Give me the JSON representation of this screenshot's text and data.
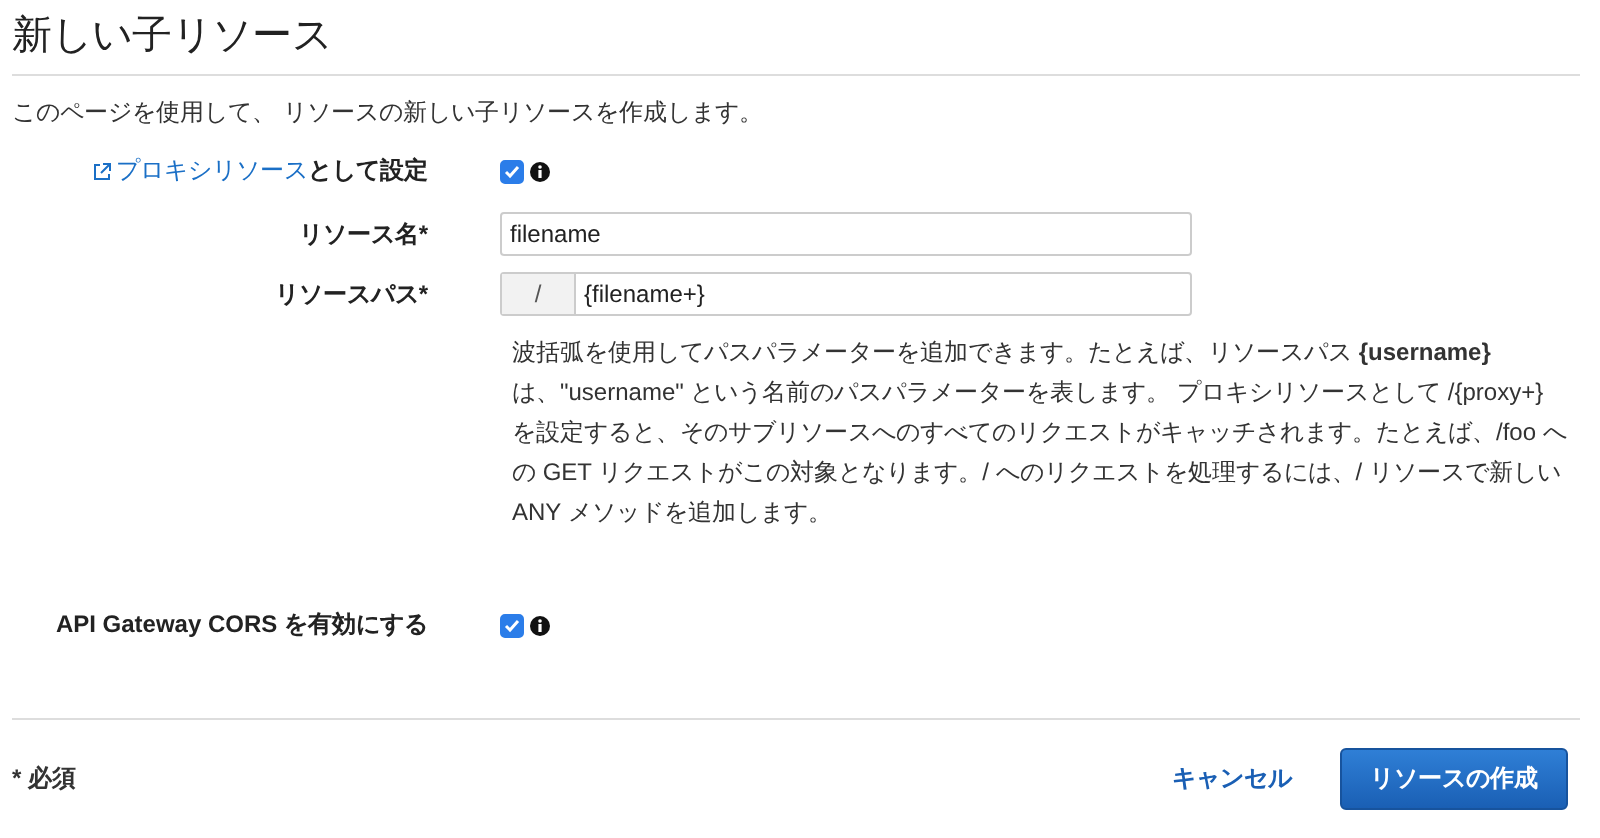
{
  "title": "新しい子リソース",
  "description": "このページを使用して、 リソースの新しい子リソースを作成します。",
  "proxy": {
    "link": "プロキシリソース",
    "suffix": "として設定",
    "checked": true
  },
  "fields": [
    {
      "label": "リソース名*",
      "value": "filename"
    },
    {
      "label": "リソースパス*",
      "prefix": "/",
      "value": "{filename+}"
    }
  ],
  "help": "波括弧を使用してパスパラメーターを追加できます。たとえば、リソースパス **{username}** は、\"username\" という名前のパスパラメーターを表します。 プロキシリソースとして /{proxy+} を設定すると、そのサブリソースへのすべてのリクエストがキャッチされます。たとえば、/foo への GET リクエストがこの対象となります。/ へのリクエストを処理するには、/ リソースで新しい ANY メソッドを追加します。",
  "cors": {
    "label": "API Gateway CORS を有効にする",
    "checked": true
  },
  "required_note": "* 必須",
  "buttons": {
    "cancel": "キャンセル",
    "create": "リソースの作成"
  }
}
